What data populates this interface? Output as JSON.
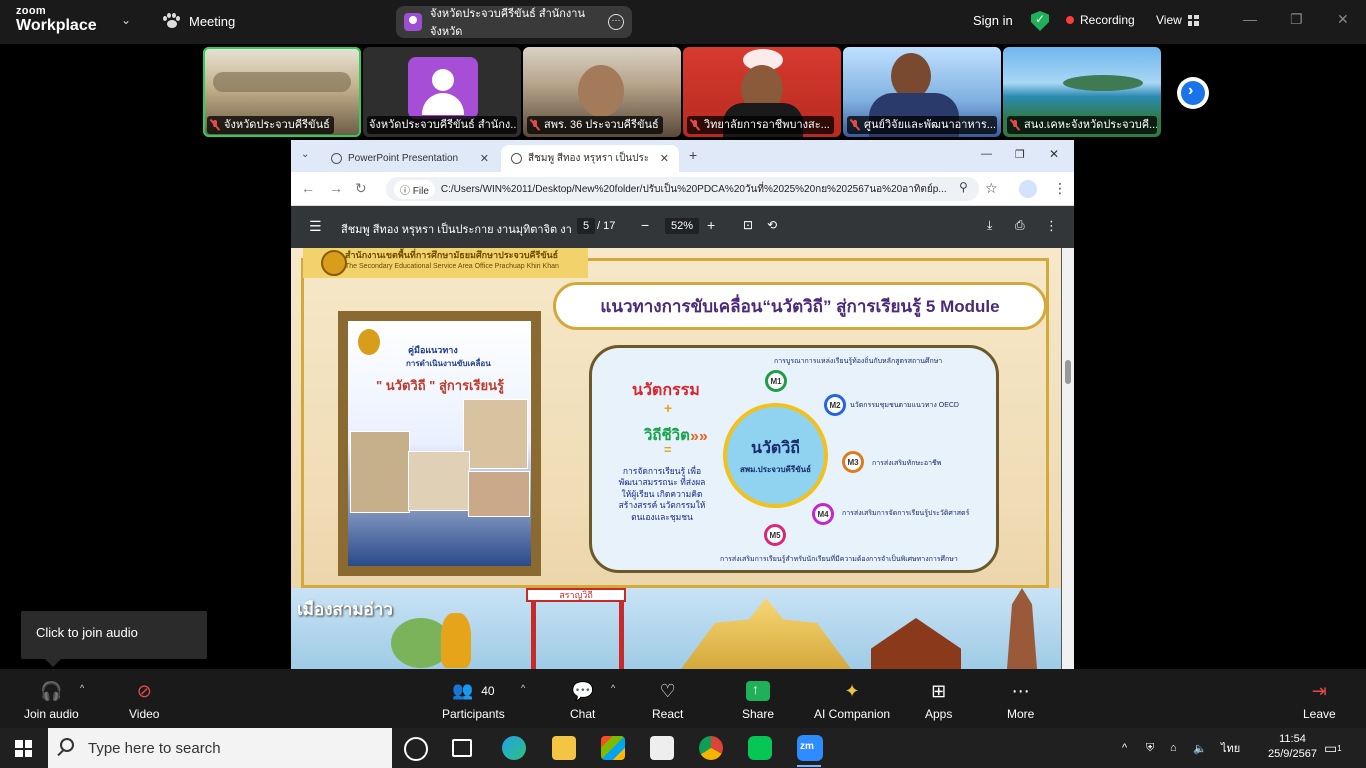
{
  "zoom": {
    "logo_top": "zoom",
    "logo_bottom": "Workplace",
    "meeting_label": "Meeting",
    "speaking_name": "จังหวัดประจวบคีรีขันธ์ สำนักงานจังหวัด",
    "sign_in": "Sign in",
    "recording": "Recording",
    "view": "View"
  },
  "thumbnails": [
    {
      "label": "จังหวัดประจวบคีรีขันธ์"
    },
    {
      "label": "จังหวัดประจวบคีรีขันธ์ สำนักง..."
    },
    {
      "label": "สพร. 36 ประจวบคีรีขันธ์"
    },
    {
      "label": "วิทยาลัยการอาชีพบางสะ..."
    },
    {
      "label": "ศูนย์วิจัยและพัฒนาอาหาร..."
    },
    {
      "label": "สนง.เคหะจังหวัดประจวบคี..."
    }
  ],
  "browser": {
    "tabs": [
      {
        "label": "PowerPoint Presentation"
      },
      {
        "label": "สีชมพู สีทอง หรุหรา เป็นประกาย งาน"
      }
    ],
    "file_chip": "File",
    "url": "C:/Users/WIN%2011/Desktop/New%20folder/ปรับเป็น%20PDCA%20วันที่%2025%20กย%202567นอ%20อาทิตย์p...",
    "pdf_title": "สีชมพู สีทอง หรุหรา เป็นประกาย งานมุทิตาจิต งา...",
    "page_current": "5",
    "page_total": "/ 17",
    "zoom": "52%"
  },
  "slide": {
    "office_th": "สำนักงานเขตพื้นที่การศึกษามัธยมศึกษาประจวบคีรีขันธ์",
    "office_en": "The Secondary Educational Service Area Office Prachuap Khiri Khan",
    "title": "แนวทางการขับเคลื่อน“นวัตวิถี” สู่การเรียนรู้ 5 Module",
    "book_h1": "คู่มือแนวทาง",
    "book_h2": "การดำเนินงานขับเคลื่อน",
    "book_h3": "\" นวัตวิถี \" สู่การเรียนรู้",
    "left_1": "นวัตกรรม",
    "plus": "+",
    "left_2": "วิถีชีวิต",
    "equals": "=",
    "left_desc": "การจัดการเรียนรู้ เพื่อพัฒนาสมรรถนะ ที่ส่งผลให้ผู้เรียน เกิดความคิดสร้างสรรค์ นวัตกรรมให้ตนเองและชุมชน",
    "hub_title": "นวัตวิถี",
    "hub_sub": "สพม.ประจวบคีรีขันธ์",
    "modules": [
      {
        "id": "M1",
        "text": "การบูรณาการแหล่งเรียนรู้ท้องถิ่นกับหลักสูตรสถานศึกษา"
      },
      {
        "id": "M2",
        "text": "นวัตกรรมชุมชนตามแนวทาง OECD"
      },
      {
        "id": "M3",
        "text": "การส่งเสริมทักษะอาชีพ"
      },
      {
        "id": "M4",
        "text": "การส่งเสริมการจัดการเรียนรู้ประวัติศาสตร์"
      },
      {
        "id": "M5",
        "text": "การส่งเสริมการเรียนรู้สำหรับนักเรียนที่มีความต้องการจำเป็นพิเศษทางการศึกษา"
      }
    ],
    "bottom_left": "เมืองสามอ่าว",
    "sign": "สราญวิถี"
  },
  "tooltip": "Click to join audio",
  "controls": {
    "join_audio": "Join audio",
    "video": "Video",
    "participants": "Participants",
    "participants_count": "40",
    "chat": "Chat",
    "react": "React",
    "share": "Share",
    "ai_companion": "AI Companion",
    "apps": "Apps",
    "more": "More",
    "leave": "Leave"
  },
  "taskbar": {
    "search_placeholder": "Type here to search",
    "lang": "ไทย",
    "time": "11:54",
    "date": "25/9/2567",
    "notifications": "1"
  },
  "colors": {
    "zoom_bg": "#1a1a1a",
    "active_green": "#28d15b",
    "record_red": "#ff3b3b",
    "share_green": "#1eb15a",
    "slide_purple": "#4b2a7a"
  }
}
